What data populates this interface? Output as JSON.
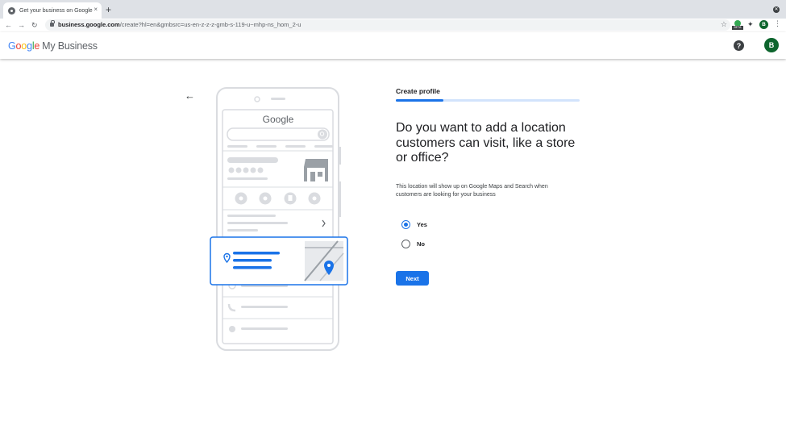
{
  "browser": {
    "tab_title": "Get your business on Google",
    "tab_close": "×",
    "new_tab": "+",
    "url_host": "business.google.com",
    "url_path": "/create?hl=en&gmbsrc=us-en-z-z-z-gmb-s-119-u~mhp-ns_hom_2-u",
    "extension_badge": "BETA",
    "profile_initial": "B"
  },
  "header": {
    "logo_letters": [
      "G",
      "o",
      "o",
      "g",
      "l",
      "e"
    ],
    "product_name": "My Business",
    "help": "?",
    "avatar_initial": "B"
  },
  "illustration": {
    "phone_brand": "Google"
  },
  "form": {
    "step_label": "Create profile",
    "progress": 0.26,
    "question": "Do you want to add a location customers can visit, like a store or office?",
    "description": "This location will show up on Google Maps and Search when customers are looking for your business",
    "options": [
      {
        "label": "Yes",
        "selected": true
      },
      {
        "label": "No",
        "selected": false
      }
    ],
    "next_label": "Next"
  },
  "colors": {
    "primary": "#1a73e8",
    "avatar": "#0d652d"
  },
  "icons": [
    "back-arrow-icon",
    "help-icon",
    "star-icon",
    "puzzle-icon",
    "location-pin-icon",
    "chevron-right-icon"
  ]
}
